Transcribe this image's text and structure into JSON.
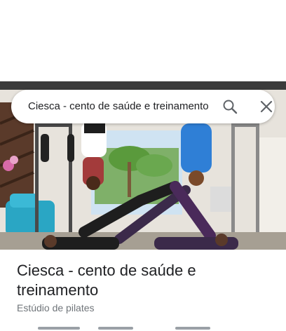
{
  "search": {
    "query": "Ciesca - cento de saúde e treinamento",
    "search_icon": "search-icon",
    "close_icon": "close-icon"
  },
  "place": {
    "photo": "place-photo",
    "title": "Ciesca - cento de saúde e treinamento",
    "category": "Estúdio de pilates"
  },
  "colors": {
    "title_text": "#202124",
    "secondary_text": "#70757a",
    "icon": "#5f6368"
  }
}
